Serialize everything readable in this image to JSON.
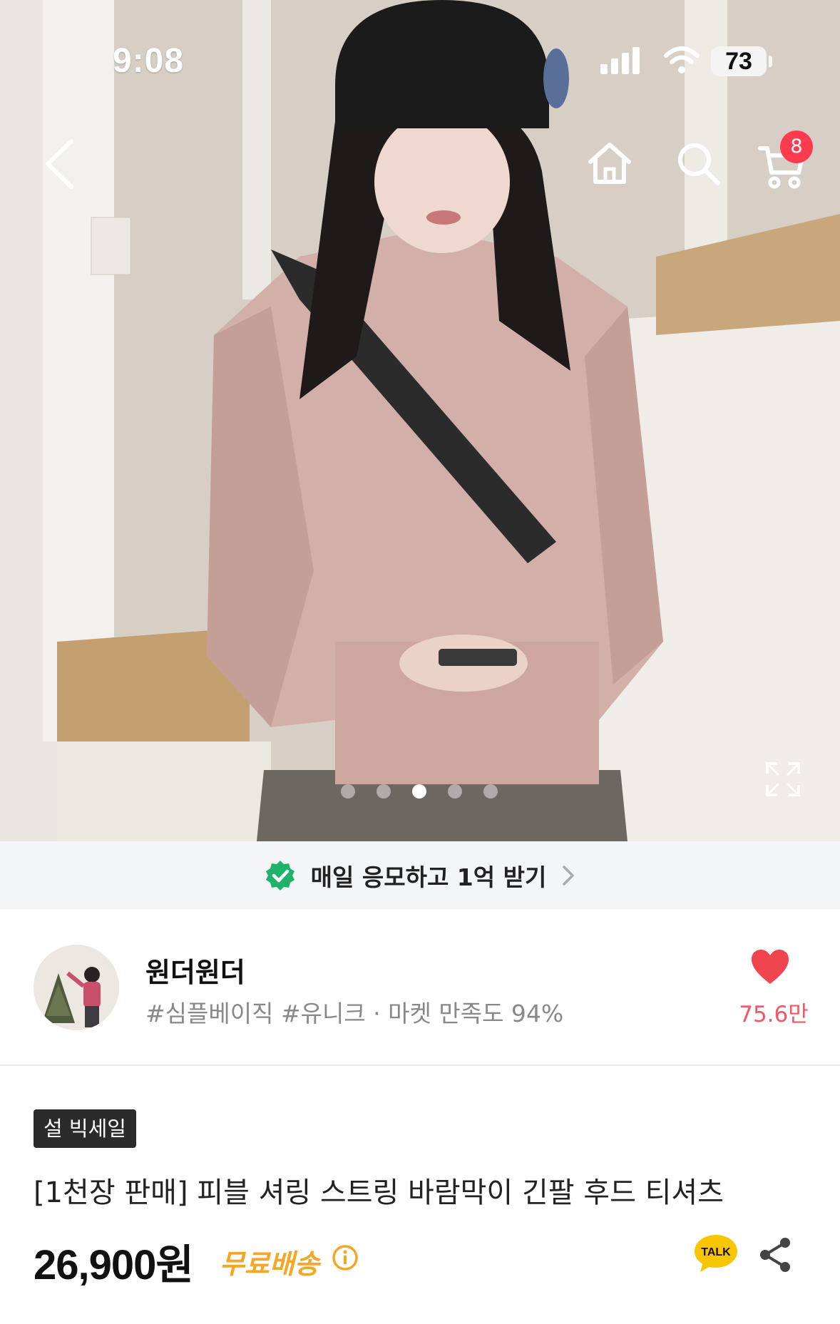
{
  "status_bar": {
    "time": "9:08",
    "battery": "73"
  },
  "nav": {
    "cart_count": "8"
  },
  "gallery": {
    "total": 5,
    "active_index": 2
  },
  "banner": {
    "text": "매일 응모하고 1억 받기"
  },
  "store": {
    "name": "원더원더",
    "meta": "#심플베이직 #유니크 · 마켓 만족도 94%",
    "likes": "75.6만"
  },
  "product": {
    "tag": "설 빅세일",
    "title": "[1천장 판매] 피블 셔링 스트링 바람막이 긴팔 후드 티셔츠",
    "price": "26,900",
    "price_unit": "원",
    "shipping": "무료배송",
    "talk_label": "TALK"
  },
  "colors": {
    "cart_badge": "#ff3b4f",
    "banner_check": "#1fb36a",
    "heart": "#f0444f",
    "shipping": "#f5a623"
  }
}
